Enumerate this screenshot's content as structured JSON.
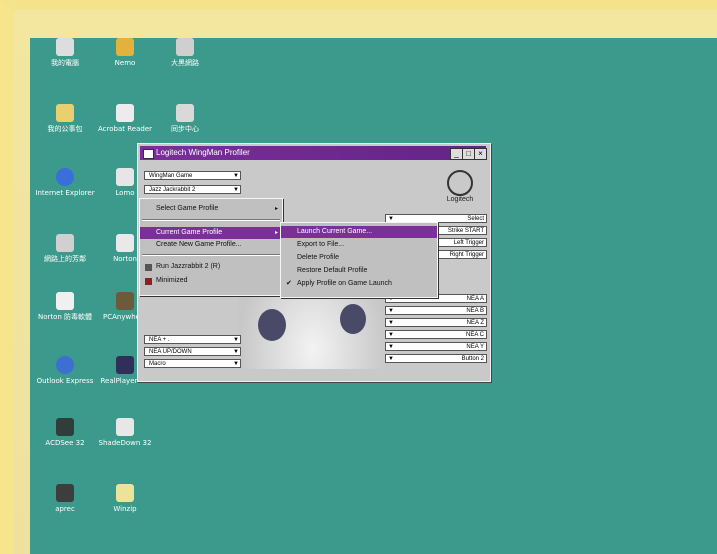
{
  "desktop": {
    "icons": [
      {
        "label": "我的電腦"
      },
      {
        "label": "Nemo"
      },
      {
        "label": "大黑網路"
      },
      {
        "label": "我的公事包"
      },
      {
        "label": "Acrobat Reader"
      },
      {
        "label": "同步中心"
      },
      {
        "label": "Internet Explorer"
      },
      {
        "label": "Lomo"
      },
      {
        "label": "網路上的芳鄰"
      },
      {
        "label": "Norton"
      },
      {
        "label": "Norton 防毒軟體"
      },
      {
        "label": "PCAnywhere"
      },
      {
        "label": "Outlook Express"
      },
      {
        "label": "RealPlayer G2"
      },
      {
        "label": "ACDSee 32"
      },
      {
        "label": "ShadeDown 32"
      },
      {
        "label": "aprec"
      },
      {
        "label": "Winzip"
      }
    ]
  },
  "window": {
    "title": "Logitech WingMan Profiler",
    "logo_text": "Logitech",
    "combos": [
      "WingMan Game",
      "Jazz Jackrabbit 2"
    ],
    "right_combos": [
      "Select",
      "Strike START",
      "Left Trigger",
      "Right Trigger"
    ],
    "right_combos_lower": [
      "NEA A",
      "NEA B",
      "NEA Z",
      "NEA C",
      "NEA Y",
      "Button 2"
    ],
    "bottom_combos": [
      "NEA + .",
      "NEA UP/DOWN",
      "Macro"
    ]
  },
  "menu_main": {
    "items": [
      {
        "label": "Select Game Profile"
      },
      {
        "label": "Current Game Profile"
      },
      {
        "label": "Create New Game Profile..."
      },
      {
        "label": "Run Jazzrabbit 2 (R)"
      },
      {
        "label": "Minimized"
      }
    ]
  },
  "menu_sub": {
    "items": [
      {
        "label": "Launch Current Game..."
      },
      {
        "label": "Export to File..."
      },
      {
        "label": "Delete Profile"
      },
      {
        "label": "Restore Default Profile"
      },
      {
        "label": "Apply Profile on Game Launch"
      }
    ],
    "checkmark": "✔"
  }
}
